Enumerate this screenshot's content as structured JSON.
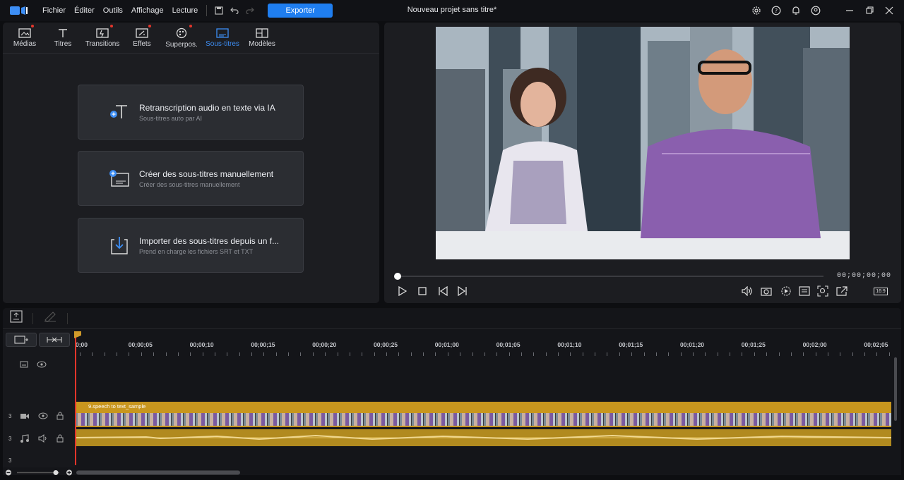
{
  "menu": [
    "Fichier",
    "Éditer",
    "Outils",
    "Affichage",
    "Lecture"
  ],
  "toolbar": {
    "export_label": "Exporter"
  },
  "project_title": "Nouveau projet sans titre*",
  "tabs": [
    {
      "label": "Médias",
      "icon": "media-icon",
      "dot": true
    },
    {
      "label": "Titres",
      "icon": "title-icon",
      "dot": false
    },
    {
      "label": "Transitions",
      "icon": "transition-icon",
      "dot": true
    },
    {
      "label": "Effets",
      "icon": "effects-icon",
      "dot": true
    },
    {
      "label": "Superpos.",
      "icon": "overlay-icon",
      "dot": true
    },
    {
      "label": "Sous-titres",
      "icon": "subtitle-icon",
      "dot": false,
      "active": true
    },
    {
      "label": "Modèles",
      "icon": "templates-icon",
      "dot": false
    }
  ],
  "cards": [
    {
      "title": "Retranscription audio en texte via IA",
      "subtitle": "Sous-titres auto par AI"
    },
    {
      "title": "Créer des sous-titres manuellement",
      "subtitle": "Créer des sous-titres manuellement"
    },
    {
      "title": "Importer des sous-titres depuis un f...",
      "subtitle": "Prend en charge les fichiers SRT et TXT"
    }
  ],
  "player": {
    "timecode": "00;00;00;00",
    "aspect": "16:9",
    "progress": 0
  },
  "ruler": [
    "0;00",
    "00;00;05",
    "00;00;10",
    "00;00;15",
    "00;00;20",
    "00;00;25",
    "00;01;00",
    "00;01;05",
    "00;01;10",
    "00;01;15",
    "00;01;20",
    "00;01;25",
    "00;02;00",
    "00;02;05"
  ],
  "tracks": {
    "video_num": "3",
    "audio_num": "3",
    "bottom_num": "3"
  },
  "clip": {
    "name": "9.speech to text_sample"
  },
  "colors": {
    "accent": "#1f7ef0",
    "clip": "#c8961e",
    "playhead": "#e2352b"
  }
}
